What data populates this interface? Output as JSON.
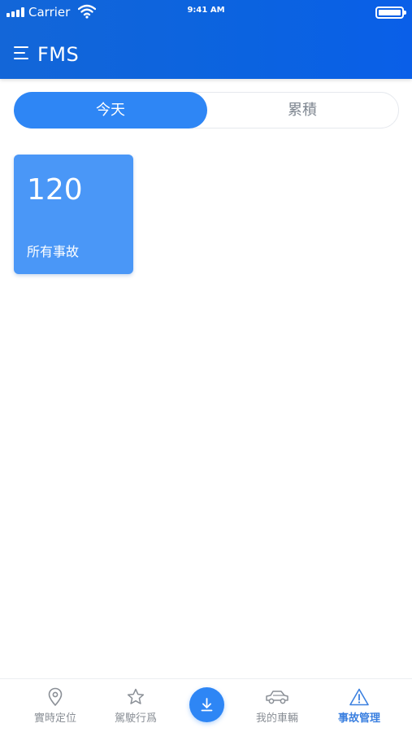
{
  "status_bar": {
    "carrier": "Carrier",
    "time": "9:41 AM"
  },
  "app_bar": {
    "title": "FMS"
  },
  "segments": {
    "today": "今天",
    "total": "累積",
    "selected": "today"
  },
  "stat_card": {
    "value": "120",
    "label": "所有事故"
  },
  "tabs": [
    {
      "label": "實時定位",
      "icon": "location-pin-icon"
    },
    {
      "label": "駕駛行爲",
      "icon": "star-icon"
    },
    {
      "label": "我的車輛",
      "icon": "car-icon"
    },
    {
      "label": "事故管理",
      "icon": "warning-icon",
      "active": true
    }
  ],
  "fab": {
    "icon": "download-icon"
  },
  "colors": {
    "primary": "#0b63e0",
    "accent": "#2e86f5",
    "card": "#4a97f7",
    "tab_inactive": "#8a8f96",
    "tab_active": "#3b80e0"
  }
}
